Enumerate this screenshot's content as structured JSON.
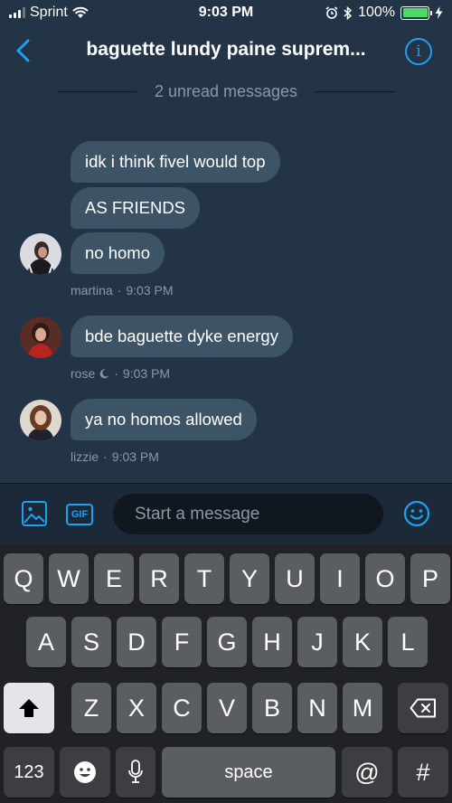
{
  "status_bar": {
    "carrier": "Sprint",
    "time": "9:03 PM",
    "battery": "100%",
    "battery_level": 1.0,
    "battery_color": "#4cd964"
  },
  "header": {
    "title": "baguette lundy paine suprem...",
    "back_icon": "chevron-left-icon",
    "info_icon": "info-icon",
    "info_glyph": "i",
    "accent_color": "#1da1f2"
  },
  "unread_divider": "2 unread messages",
  "messages": [
    {
      "sender": "martina",
      "time": "9:03 PM",
      "bubbles": [
        "idk i think fivel would top",
        "AS FRIENDS",
        "no homo"
      ]
    },
    {
      "sender": "rose",
      "sender_icon": "moon-icon",
      "time": "9:03 PM",
      "bubbles": [
        "bde baguette dyke energy"
      ]
    },
    {
      "sender": "lizzie",
      "time": "9:03 PM",
      "bubbles": [
        "ya no homos allowed"
      ]
    }
  ],
  "composer": {
    "placeholder": "Start a message",
    "media_icon": "image-icon",
    "gif_label": "GIF",
    "emoji_icon": "smiley-icon"
  },
  "keyboard": {
    "row1": [
      "Q",
      "W",
      "E",
      "R",
      "T",
      "Y",
      "U",
      "I",
      "O",
      "P"
    ],
    "row2": [
      "A",
      "S",
      "D",
      "F",
      "G",
      "H",
      "J",
      "K",
      "L"
    ],
    "row3": [
      "Z",
      "X",
      "C",
      "V",
      "B",
      "N",
      "M"
    ],
    "numbers_label": "123",
    "space_label": "space",
    "at_label": "@",
    "hash_label": "#"
  }
}
